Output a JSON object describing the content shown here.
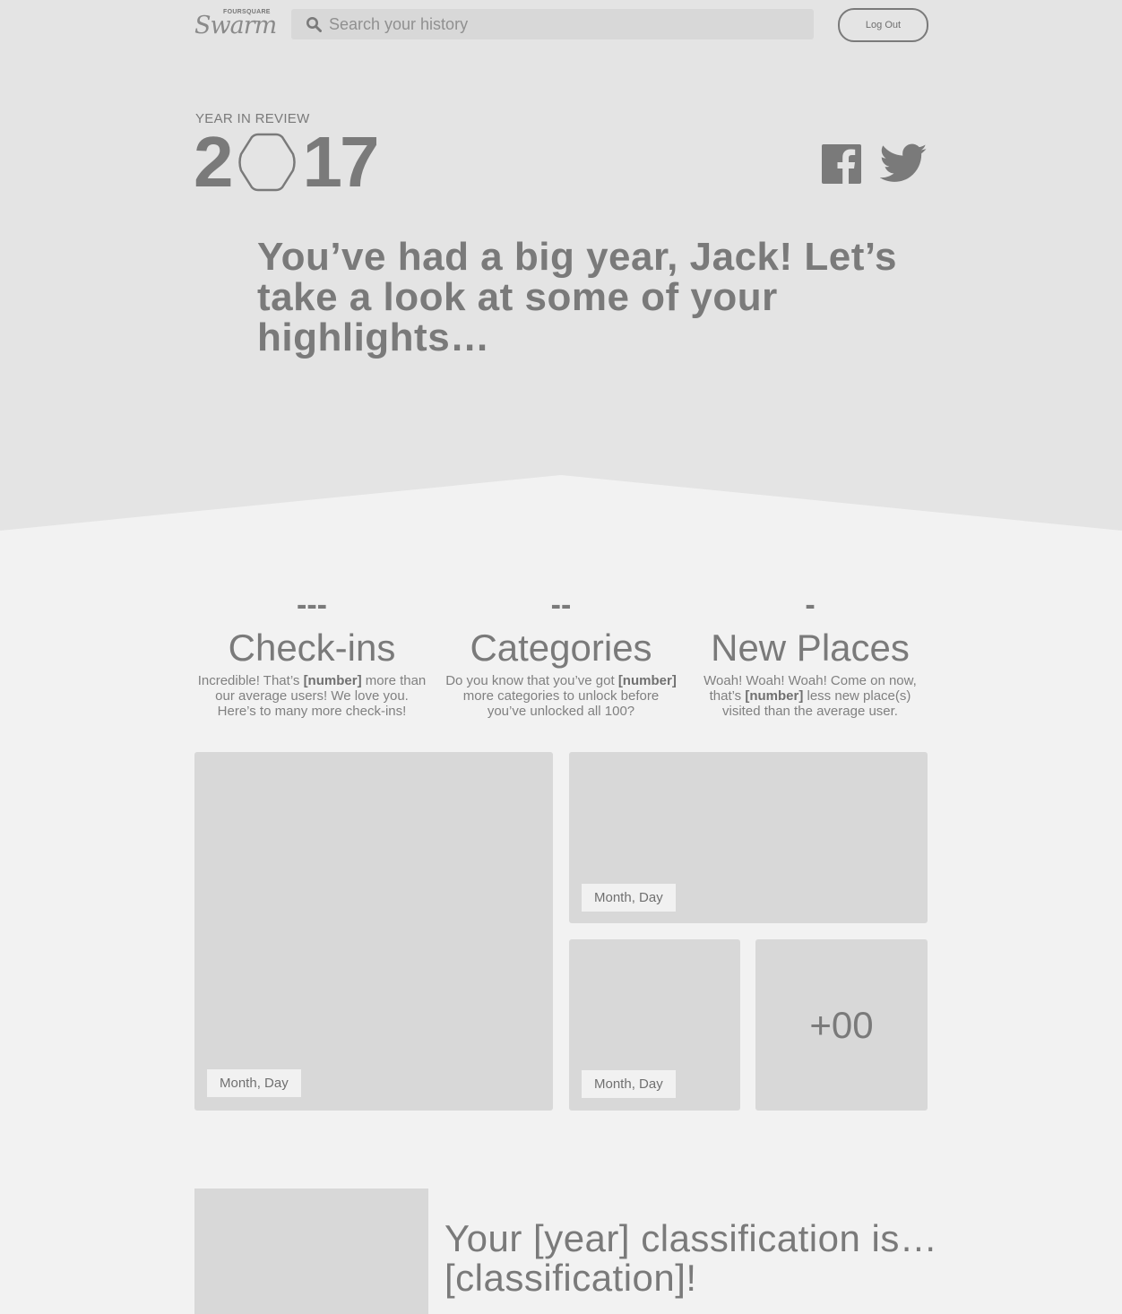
{
  "header": {
    "logo_small": "FOURSQUARE",
    "logo_main": "Swarm",
    "search_placeholder": "Search your history",
    "logout_label": "Log Out"
  },
  "hero": {
    "eyebrow": "YEAR IN REVIEW",
    "year_start": "2",
    "year_end": "17",
    "headline": "You’ve had a big year, Jack! Let’s take a look at some of your highlights…"
  },
  "stats": [
    {
      "value": "---",
      "label": "Check-ins",
      "desc_a": "Incredible! That’s ",
      "desc_bold": "[number]",
      "desc_b": " more than our average users! We love you. Here’s to many more check-ins!"
    },
    {
      "value": "--",
      "label": "Categories",
      "desc_a": "Do you know that you’ve got ",
      "desc_bold": "[number]",
      "desc_b": " more categories to unlock before you’ve unlocked all 100?"
    },
    {
      "value": "-",
      "label": "New Places",
      "desc_a": "Woah! Woah! Woah! Come on now, that’s ",
      "desc_bold": "[number]",
      "desc_b": " less new place(s) visited than the average user."
    }
  ],
  "tiles": {
    "large_date": "Month, Day",
    "wide_date": "Month, Day",
    "small_date": "Month, Day",
    "more_count": "+00"
  },
  "classification": {
    "title": "Your [year] classification is… [classification]!"
  },
  "icons": {
    "search": "search-icon",
    "facebook": "facebook-icon",
    "twitter": "twitter-icon",
    "hexagon": "hexagon-icon"
  },
  "colors": {
    "hero_bg": "#e4e4e4",
    "page_bg": "#f2f2f2",
    "tile_bg": "#d8d8d8",
    "text": "#7a7a7a"
  }
}
